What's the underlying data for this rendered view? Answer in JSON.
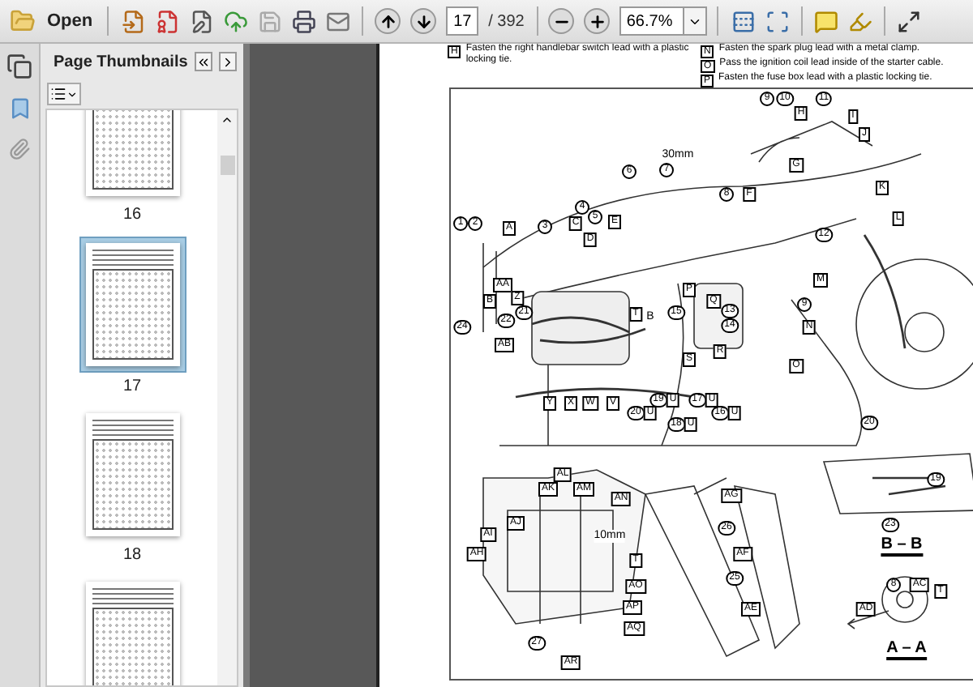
{
  "toolbar": {
    "open_label": "Open",
    "page": "17",
    "page_total": "/ 392",
    "zoom": "66.7%"
  },
  "sidebar": {
    "title": "Page Thumbnails",
    "thumbnails": [
      {
        "label": "16",
        "selected": false
      },
      {
        "label": "17",
        "selected": true
      },
      {
        "label": "18",
        "selected": false
      },
      {
        "selected": false
      }
    ]
  },
  "notes_left": [
    {
      "mark": "H",
      "text": "Fasten the right handlebar switch lead with a plastic locking tie."
    }
  ],
  "notes_right": [
    {
      "mark": "N",
      "text": "Fasten the spark plug lead with a metal clamp."
    },
    {
      "mark": "O",
      "text": "Pass the ignition coil lead inside of the starter cable."
    },
    {
      "mark": "P",
      "text": "Fasten the fuse box lead with a plastic locking tie."
    }
  ],
  "callouts": [
    {
      "text": "9",
      "kind": "circled"
    },
    {
      "text": "10",
      "kind": "circled"
    },
    {
      "text": "11",
      "kind": "circled"
    },
    {
      "text": "H",
      "kind": "boxed"
    },
    {
      "text": "I",
      "kind": "boxed"
    },
    {
      "text": "J",
      "kind": "boxed"
    },
    {
      "text": "30mm",
      "kind": "plain"
    },
    {
      "text": "G",
      "kind": "boxed"
    },
    {
      "text": "7",
      "kind": "circled"
    },
    {
      "text": "6",
      "kind": "circled"
    },
    {
      "text": "8",
      "kind": "circled"
    },
    {
      "text": "F",
      "kind": "boxed"
    },
    {
      "text": "K",
      "kind": "boxed"
    },
    {
      "text": "L",
      "kind": "boxed"
    },
    {
      "text": "12",
      "kind": "circled"
    },
    {
      "text": "M",
      "kind": "boxed"
    },
    {
      "text": "9",
      "kind": "circled"
    },
    {
      "text": "N",
      "kind": "boxed"
    },
    {
      "text": "O",
      "kind": "boxed"
    },
    {
      "text": "1",
      "kind": "circled"
    },
    {
      "text": "2",
      "kind": "circled"
    },
    {
      "text": "A",
      "kind": "boxed"
    },
    {
      "text": "3",
      "kind": "circled"
    },
    {
      "text": "4",
      "kind": "circled"
    },
    {
      "text": "C",
      "kind": "boxed"
    },
    {
      "text": "D",
      "kind": "boxed"
    },
    {
      "text": "5",
      "kind": "circled"
    },
    {
      "text": "E",
      "kind": "boxed"
    },
    {
      "text": "AA",
      "kind": "boxed"
    },
    {
      "text": "B",
      "kind": "boxed"
    },
    {
      "text": "Z",
      "kind": "boxed"
    },
    {
      "text": "21",
      "kind": "circled"
    },
    {
      "text": "22",
      "kind": "circled"
    },
    {
      "text": "24",
      "kind": "circled"
    },
    {
      "text": "AB",
      "kind": "boxed"
    },
    {
      "text": "T",
      "kind": "boxed"
    },
    {
      "text": "B",
      "kind": "plain"
    },
    {
      "text": "P",
      "kind": "boxed"
    },
    {
      "text": "Q",
      "kind": "boxed"
    },
    {
      "text": "15",
      "kind": "circled"
    },
    {
      "text": "13",
      "kind": "circled"
    },
    {
      "text": "14",
      "kind": "circled"
    },
    {
      "text": "R",
      "kind": "boxed"
    },
    {
      "text": "S",
      "kind": "boxed"
    },
    {
      "text": "Y",
      "kind": "boxed"
    },
    {
      "text": "X",
      "kind": "boxed"
    },
    {
      "text": "W",
      "kind": "boxed"
    },
    {
      "text": "V",
      "kind": "boxed"
    },
    {
      "text": "20",
      "kind": "circled"
    },
    {
      "text": "U",
      "kind": "boxed"
    },
    {
      "text": "19",
      "kind": "circled"
    },
    {
      "text": "U",
      "kind": "boxed"
    },
    {
      "text": "18",
      "kind": "circled"
    },
    {
      "text": "U",
      "kind": "boxed"
    },
    {
      "text": "17",
      "kind": "circled"
    },
    {
      "text": "U",
      "kind": "boxed"
    },
    {
      "text": "16",
      "kind": "circled"
    },
    {
      "text": "U",
      "kind": "boxed"
    },
    {
      "text": "20",
      "kind": "circled"
    },
    {
      "text": "19",
      "kind": "circled"
    },
    {
      "text": "23",
      "kind": "circled"
    },
    {
      "text": "B – B",
      "kind": "section"
    },
    {
      "text": "8",
      "kind": "circled"
    },
    {
      "text": "AC",
      "kind": "boxed"
    },
    {
      "text": "T",
      "kind": "boxed"
    },
    {
      "text": "AD",
      "kind": "boxed"
    },
    {
      "text": "A – A",
      "kind": "section"
    },
    {
      "text": "AG",
      "kind": "boxed"
    },
    {
      "text": "26",
      "kind": "circled"
    },
    {
      "text": "AF",
      "kind": "boxed"
    },
    {
      "text": "25",
      "kind": "circled"
    },
    {
      "text": "AE",
      "kind": "boxed"
    },
    {
      "text": "AL",
      "kind": "boxed"
    },
    {
      "text": "AK",
      "kind": "boxed"
    },
    {
      "text": "AM",
      "kind": "boxed"
    },
    {
      "text": "AN",
      "kind": "boxed"
    },
    {
      "text": "AJ",
      "kind": "boxed"
    },
    {
      "text": "10mm",
      "kind": "plain"
    },
    {
      "text": "AI",
      "kind": "boxed"
    },
    {
      "text": "AH",
      "kind": "boxed"
    },
    {
      "text": "T",
      "kind": "boxed"
    },
    {
      "text": "AO",
      "kind": "boxed"
    },
    {
      "text": "AP",
      "kind": "boxed"
    },
    {
      "text": "AQ",
      "kind": "boxed"
    },
    {
      "text": "27",
      "kind": "circled"
    },
    {
      "text": "AR",
      "kind": "boxed"
    }
  ]
}
